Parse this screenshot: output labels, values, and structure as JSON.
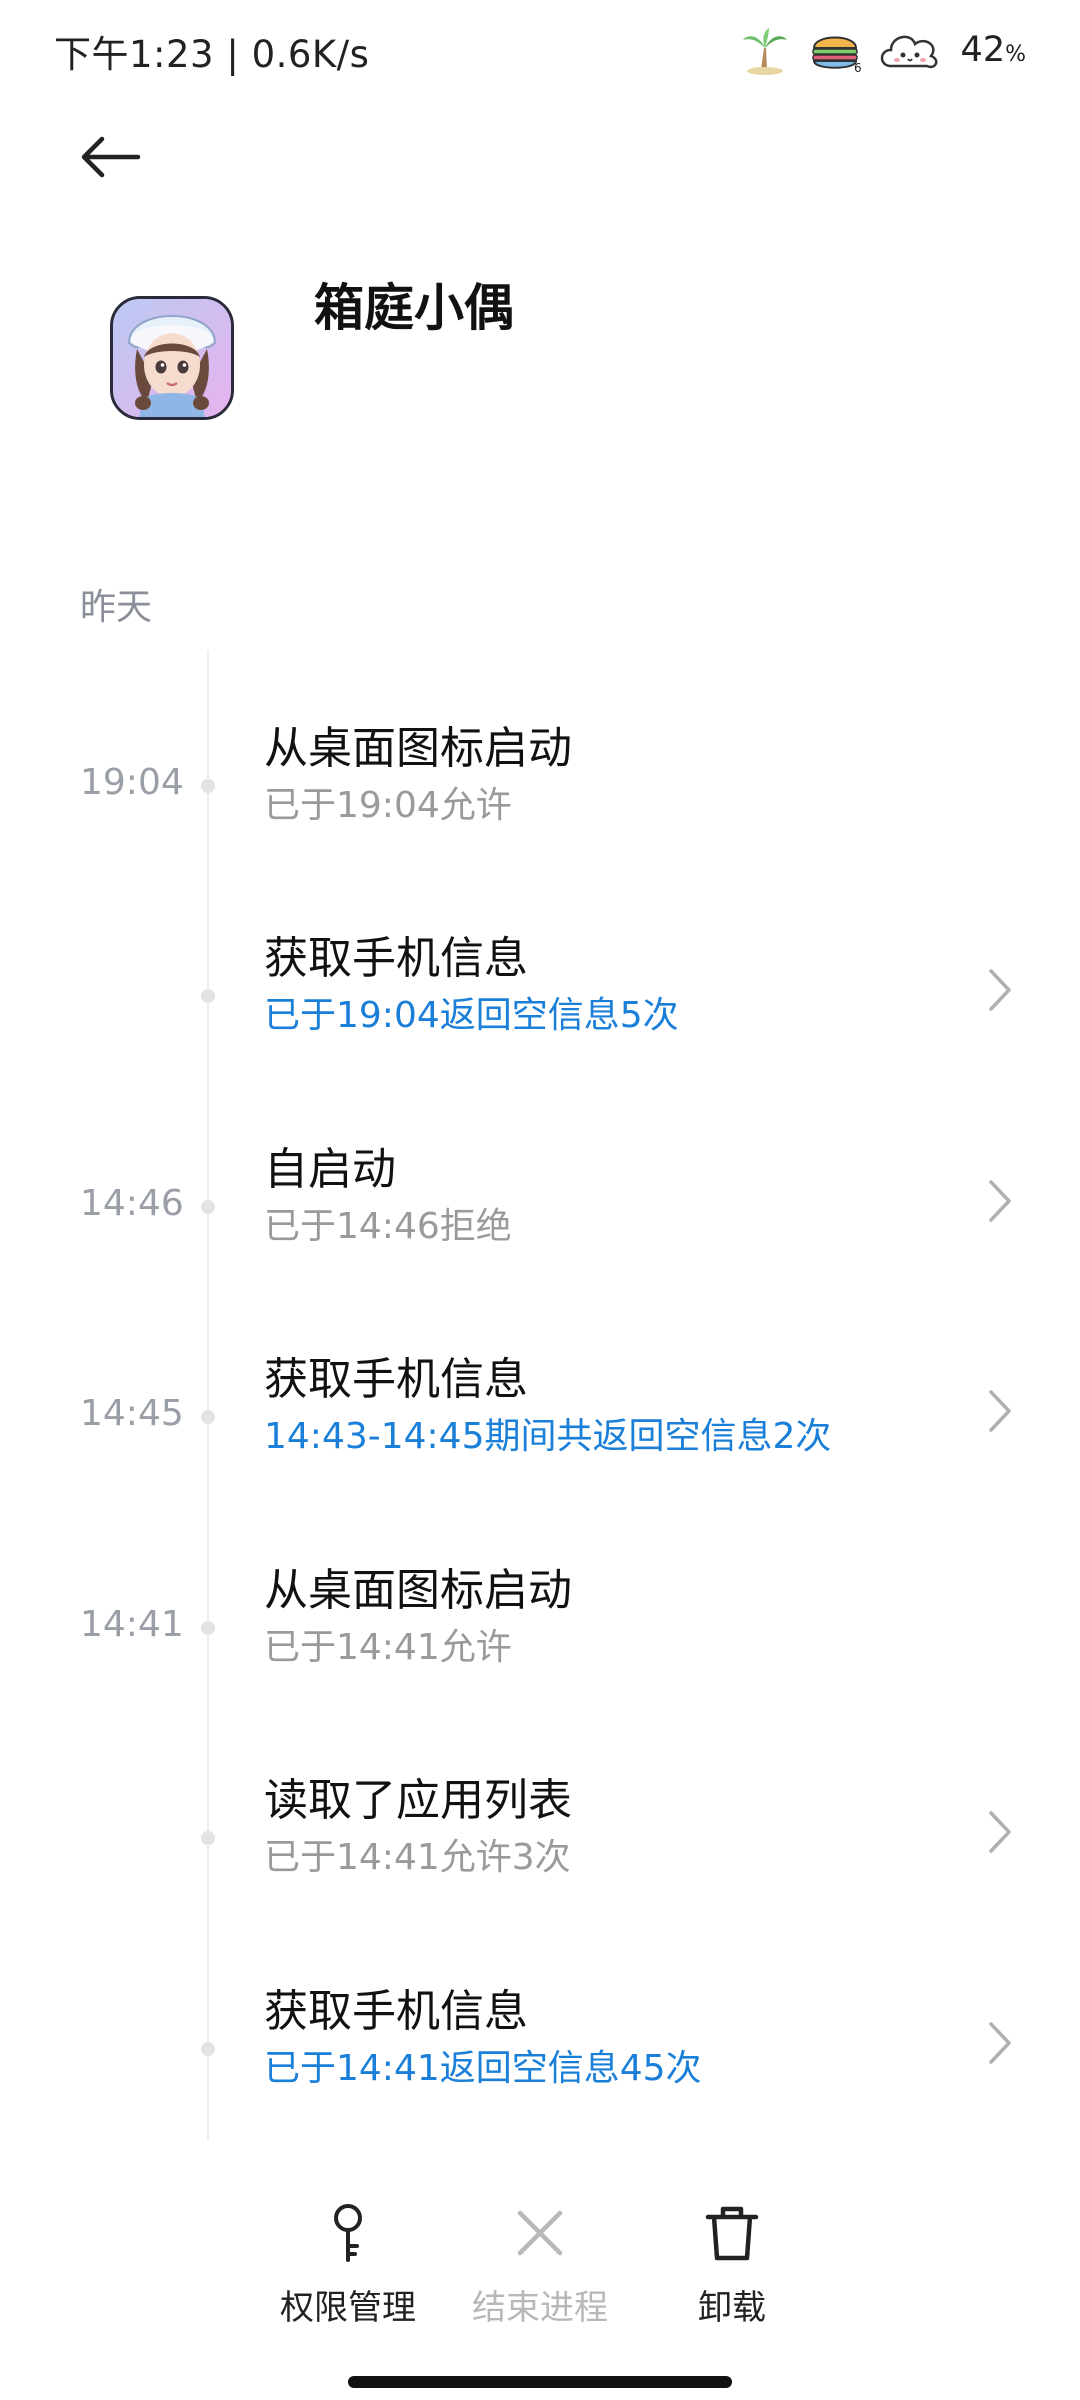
{
  "status_bar": {
    "time_speed": "下午1:23 | 0.6K/s",
    "icons": [
      "palm-tree-icon",
      "burger-icon",
      "cloud-face-icon"
    ],
    "battery": "42",
    "battery_unit": "%"
  },
  "header": {
    "app_name": "箱庭小偶",
    "app_icon": "doll-avatar-icon"
  },
  "timeline": {
    "section_label": "昨天",
    "entries": [
      {
        "time": "19:04",
        "title": "从桌面图标启动",
        "subtitle": "已于19:04允许",
        "subtitle_color": "gray",
        "has_chevron": false
      },
      {
        "time": "",
        "title": "获取手机信息",
        "subtitle": "已于19:04返回空信息5次",
        "subtitle_color": "blue",
        "has_chevron": true
      },
      {
        "time": "14:46",
        "title": "自启动",
        "subtitle": "已于14:46拒绝",
        "subtitle_color": "gray",
        "has_chevron": true
      },
      {
        "time": "14:45",
        "title": "获取手机信息",
        "subtitle": "14:43-14:45期间共返回空信息2次",
        "subtitle_color": "blue",
        "has_chevron": true
      },
      {
        "time": "14:41",
        "title": "从桌面图标启动",
        "subtitle": "已于14:41允许",
        "subtitle_color": "gray",
        "has_chevron": false
      },
      {
        "time": "",
        "title": "读取了应用列表",
        "subtitle": "已于14:41允许3次",
        "subtitle_color": "gray",
        "has_chevron": true
      },
      {
        "time": "",
        "title": "获取手机信息",
        "subtitle": "已于14:41返回空信息45次",
        "subtitle_color": "blue",
        "has_chevron": true
      }
    ]
  },
  "actions": [
    {
      "label": "权限管理",
      "icon": "key-icon",
      "enabled": true
    },
    {
      "label": "结束进程",
      "icon": "close-x-icon",
      "enabled": false
    },
    {
      "label": "卸载",
      "icon": "trash-icon",
      "enabled": true
    }
  ],
  "colors": {
    "accent_blue": "#1a7fd9",
    "secondary_gray": "#9a9a9a",
    "disabled_gray": "#b8b8b8"
  }
}
